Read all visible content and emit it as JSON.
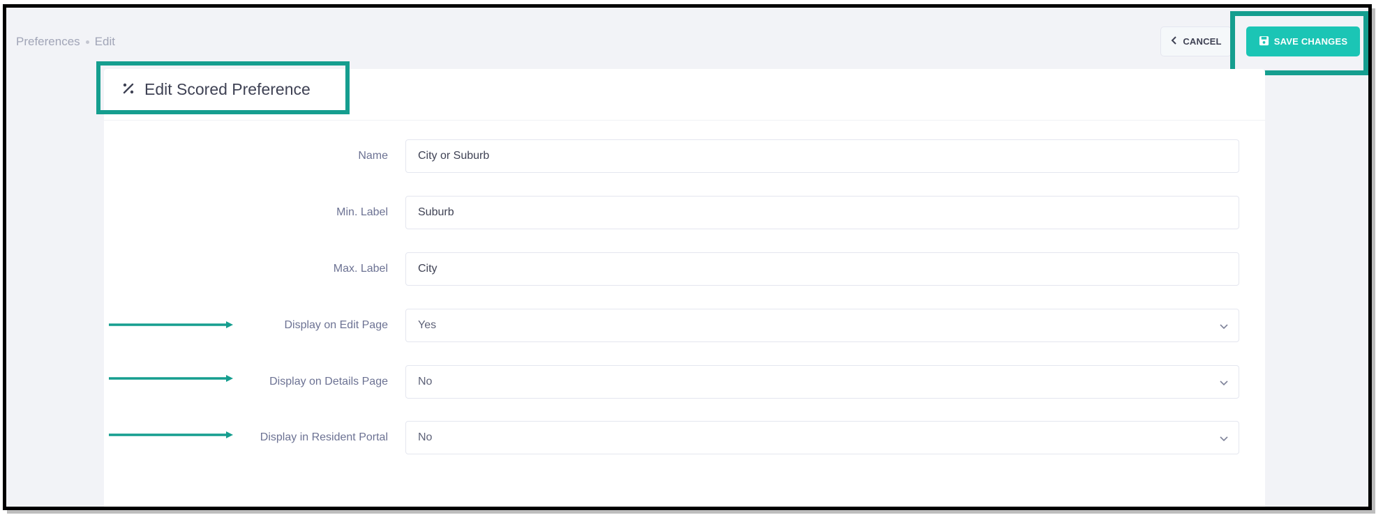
{
  "breadcrumb": {
    "root": "Preferences",
    "current": "Edit"
  },
  "toolbar": {
    "cancel_label": "CANCEL",
    "save_label": "SAVE CHANGES"
  },
  "card": {
    "title": "Edit Scored Preference"
  },
  "form": {
    "name": {
      "label": "Name",
      "value": "City or Suburb"
    },
    "min_label": {
      "label": "Min. Label",
      "value": "Suburb"
    },
    "max_label": {
      "label": "Max. Label",
      "value": "City"
    },
    "display_edit": {
      "label": "Display on Edit Page",
      "value": "Yes"
    },
    "display_details": {
      "label": "Display on Details Page",
      "value": "No"
    },
    "display_portal": {
      "label": "Display in Resident Portal",
      "value": "No"
    }
  },
  "colors": {
    "accent": "#1bc5b5",
    "highlight": "#159e8f",
    "arrow": "#159e8f"
  },
  "icons": {
    "cancel": "chevron-left-icon",
    "save": "floppy-disk-icon",
    "title": "percent-icon",
    "select": "chevron-down-icon"
  }
}
